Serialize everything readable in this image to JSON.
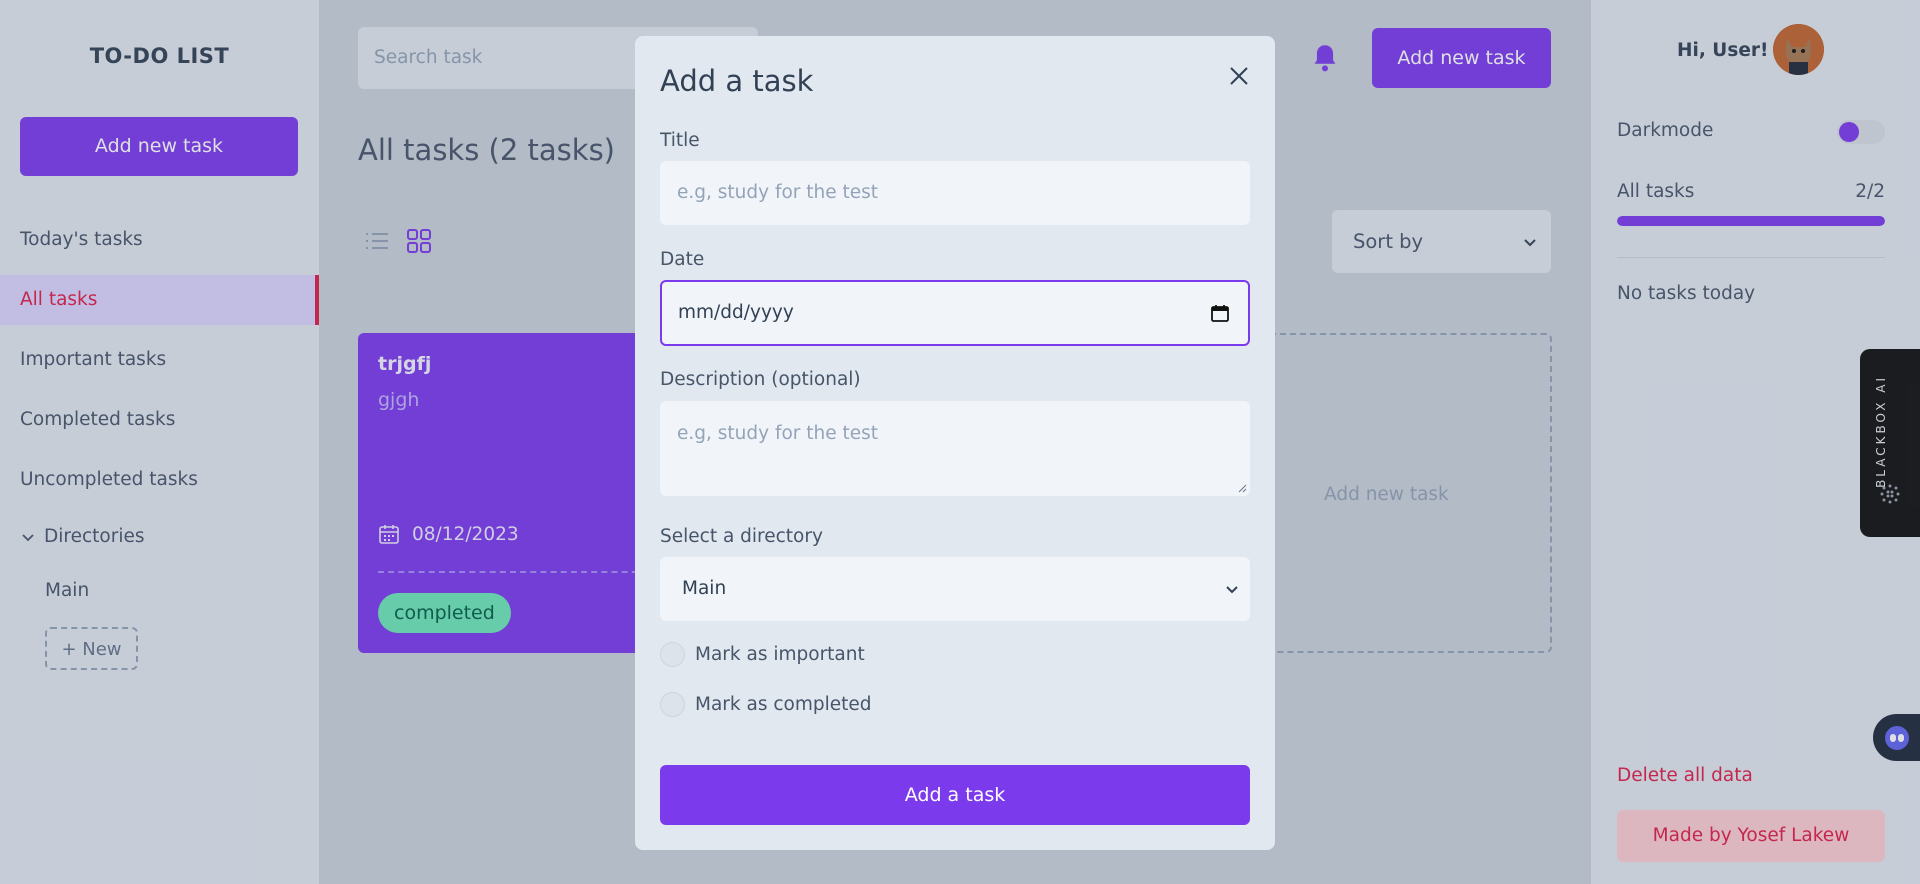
{
  "left_sidebar": {
    "brand": "TO-DO LIST",
    "add_button": "Add new task",
    "nav": [
      {
        "label": "Today's tasks"
      },
      {
        "label": "All tasks"
      },
      {
        "label": "Important tasks"
      },
      {
        "label": "Completed tasks"
      },
      {
        "label": "Uncompleted tasks"
      }
    ],
    "directories_label": "Directories",
    "directories": [
      "Main"
    ],
    "new_directory_button": "+ New"
  },
  "header": {
    "search_placeholder": "Search task",
    "add_button": "Add new task"
  },
  "main": {
    "title": "All tasks (2 tasks)",
    "sort_label": "Sort by",
    "tasks": [
      {
        "title": "trjgfj",
        "description": "gjgh",
        "date": "08/12/2023",
        "status": "completed"
      }
    ],
    "add_new_card": "Add new task"
  },
  "right_sidebar": {
    "greeting": "Hi, User!",
    "darkmode_label": "Darkmode",
    "darkmode_on": true,
    "all_tasks_label": "All tasks",
    "all_tasks_count": "2/2",
    "progress_fraction": 1.0,
    "no_tasks_today": "No tasks today",
    "delete_all": "Delete all data",
    "made_by": "Made by Yosef Lakew"
  },
  "blackbox": {
    "label": "BLACKBOX AI"
  },
  "modal": {
    "title": "Add a task",
    "title_label": "Title",
    "title_placeholder": "e.g, study for the test",
    "date_label": "Date",
    "date_placeholder": "mm/dd/yyyy",
    "description_label": "Description (optional)",
    "description_placeholder": "e.g, study for the test",
    "directory_label": "Select a directory",
    "directory_value": "Main",
    "important_label": "Mark as important",
    "completed_label": "Mark as completed",
    "submit": "Add a task"
  },
  "colors": {
    "accent": "#7c3aed",
    "danger": "#e11d48",
    "completed_badge": "#6ee7b7"
  }
}
